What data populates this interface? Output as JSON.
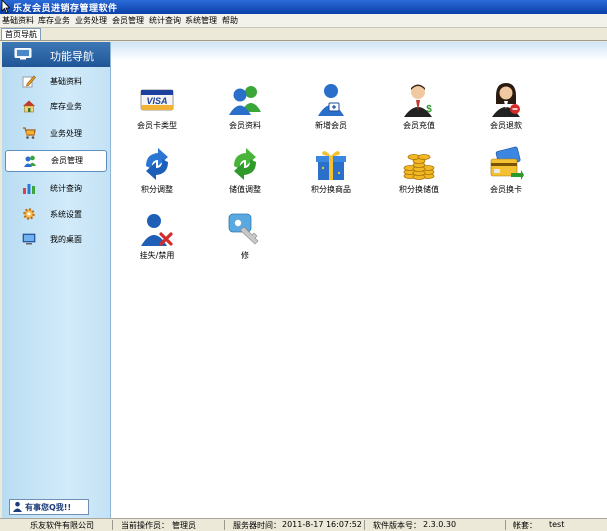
{
  "window": {
    "title": "乐友会员进销存管理软件"
  },
  "menu": [
    "基础资料",
    "库存业务",
    "业务处理",
    "会员管理",
    "统计查询",
    "系统管理",
    "帮助"
  ],
  "tabs": [
    "首页导航"
  ],
  "sidebar": {
    "header": "功能导航",
    "items": [
      {
        "label": "基础资料",
        "icon": "pencil-note-icon"
      },
      {
        "label": "库存业务",
        "icon": "house-icon"
      },
      {
        "label": "业务处理",
        "icon": "shopping-cart-icon"
      },
      {
        "label": "会员管理",
        "icon": "users-icon",
        "active": true
      },
      {
        "label": "统计查询",
        "icon": "bar-chart-icon"
      },
      {
        "label": "系统设置",
        "icon": "gear-icon"
      },
      {
        "label": "我的桌面",
        "icon": "monitor-icon"
      }
    ],
    "help": "有事您Q我!!"
  },
  "tiles": [
    {
      "label": "会员卡类型",
      "icon": "visa-card-icon"
    },
    {
      "label": "会员资料",
      "icon": "two-users-icon"
    },
    {
      "label": "新增会员",
      "icon": "add-member-icon"
    },
    {
      "label": "会员充值",
      "icon": "businessman-icon"
    },
    {
      "label": "会员退款",
      "icon": "businesswoman-icon"
    },
    {
      "label": "积分调整",
      "icon": "blue-refresh-icon"
    },
    {
      "label": "储值调整",
      "icon": "green-refresh-icon"
    },
    {
      "label": "积分换商品",
      "icon": "gift-box-icon"
    },
    {
      "label": "积分换储值",
      "icon": "gold-coins-icon"
    },
    {
      "label": "会员换卡",
      "icon": "card-swap-icon"
    },
    {
      "label": "挂失/禁用",
      "icon": "user-blocked-icon"
    },
    {
      "label": "修",
      "icon": "key-icon"
    }
  ],
  "status": {
    "company": "乐友软件有限公司",
    "operator_label": "当前操作员：",
    "operator": "管理员",
    "server_time_label": "服务器时间：",
    "server_time": "2011-8-17 16:07:52",
    "version_label": "软件版本号：",
    "version": "2.3.0.30",
    "account_label": "帐套：",
    "account": "test"
  }
}
